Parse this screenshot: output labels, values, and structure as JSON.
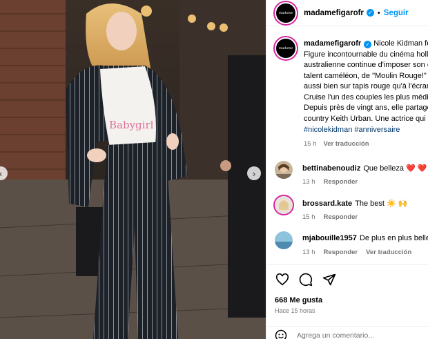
{
  "photo": {
    "shirt_text": "Babygirl"
  },
  "post": {
    "username": "madamefigarofr",
    "avatar_text": "madame",
    "follow_label": "Seguir",
    "dot": "•",
    "verified_glyph": "✓"
  },
  "caption": {
    "username": "madamefigarofr",
    "lines": [
      "Nicole Kidman fête",
      "Figure incontournable du cinéma holly",
      "australienne continue d'imposer son é",
      "talent caméléon, de \"Moulin Rouge!\" à",
      "aussi bien sur tapis rouge qu'à l'écran,",
      "Cruise l'un des couples les plus médiat",
      "Depuis près de vingt ans, elle partage",
      "country Keith Urban. Une actrice qui tr"
    ],
    "hashtags": "#nicolekidman #anniversaire",
    "time": "15 h",
    "translate_label": "Ver traducción"
  },
  "comments": [
    {
      "username": "bettinabenoudiz",
      "text": "Que belleza",
      "emoji": "❤️ ❤️ ❤️",
      "time": "13 h",
      "reply_label": "Responder",
      "translate_label": ""
    },
    {
      "username": "brossard.kate",
      "text": "The best",
      "emoji": "☀️ 🙌",
      "time": "15 h",
      "reply_label": "Responder",
      "translate_label": ""
    },
    {
      "username": "mjabouille1957",
      "text": "De plus en plus belle",
      "emoji": "",
      "time": "13 h",
      "reply_label": "Responder",
      "translate_label": "Ver traducción"
    }
  ],
  "actions": {
    "likes": "668 Me gusta",
    "ago": "Hace 15 horas",
    "add_comment_placeholder": "Agrega un comentario..."
  },
  "icons": {
    "prev": "chevron-left-icon",
    "next": "chevron-right-icon",
    "like": "heart-icon",
    "comment": "comment-icon",
    "share": "share-icon",
    "emoji": "emoji-icon"
  }
}
